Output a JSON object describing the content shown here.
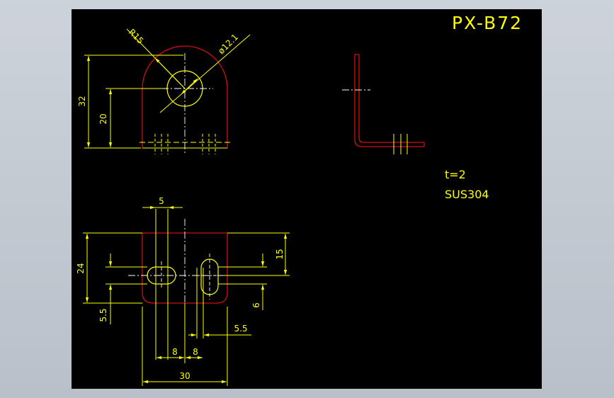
{
  "colors": {
    "background": "#000000",
    "outline": "#d01010",
    "dimension": "#ffff00",
    "centerline": "#ffffff",
    "window": "#c4cad2"
  },
  "title": "PX-B72",
  "notes": {
    "thickness": "t=2",
    "material": "SUS304"
  },
  "front_view": {
    "radius_label": "R15",
    "hole_label": "ø12.1",
    "height_total": "32",
    "height_center": "20"
  },
  "plan_view": {
    "slot_width": "5",
    "height": "24",
    "bottom_offset": "5.5",
    "right_height": "15",
    "right_bottom": "6",
    "slot_offset": "5.5",
    "left_spacing": "8",
    "right_spacing": "8",
    "width": "30"
  }
}
